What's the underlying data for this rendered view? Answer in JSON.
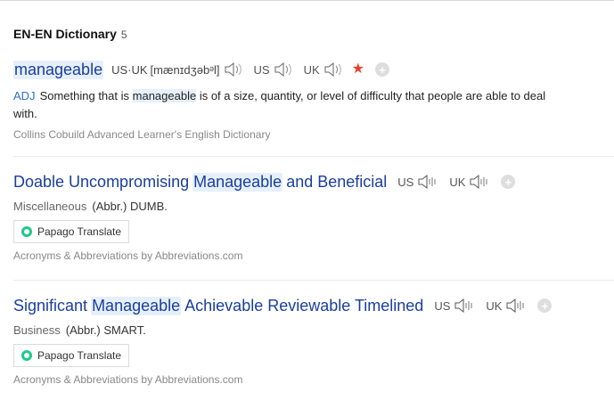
{
  "section": {
    "title": "EN-EN Dictionary",
    "count": "5"
  },
  "entry1": {
    "word": "manageable",
    "ipa_prefix": "US·UK",
    "ipa": "[mænɪdʒəbᵊl]",
    "us_label": "US",
    "uk_label": "UK",
    "pos": "ADJ",
    "def_before": "Something that is",
    "def_mark": "manageable",
    "def_after": "is of a size, quantity, or level of difficulty that people are able to deal",
    "def_cont": "with.",
    "source": "Collins Cobuild Advanced Learner's English Dictionary",
    "star_color": "#e8402c"
  },
  "entry2": {
    "w1": "Doable Uncompromising",
    "w2": "Manageable",
    "w3": "and Beneficial",
    "us_label": "US",
    "uk_label": "UK",
    "category": "Miscellaneous",
    "abbr": "(Abbr.) DUMB.",
    "translate_label": "Papago Translate",
    "source": "Acronyms & Abbreviations by Abbreviations.com"
  },
  "entry3": {
    "w1": "Significant",
    "w2": "Manageable",
    "w3": "Achievable Reviewable Timelined",
    "us_label": "US",
    "uk_label": "UK",
    "category": "Business",
    "abbr": "(Abbr.) SMART.",
    "translate_label": "Papago Translate",
    "source": "Acronyms & Abbreviations by Abbreviations.com"
  },
  "icons": {
    "speaker_outline": "speaker-outline-icon",
    "speaker_waves": "speaker-waves-icon",
    "star": "star-icon",
    "plus": "plus-icon",
    "papago": "papago-logo-icon"
  },
  "colors": {
    "link": "#1a3e9e",
    "pos": "#2b6fc7",
    "highlight": "#e6f0fb",
    "star": "#e8402c",
    "papago": "#1ec98b"
  }
}
